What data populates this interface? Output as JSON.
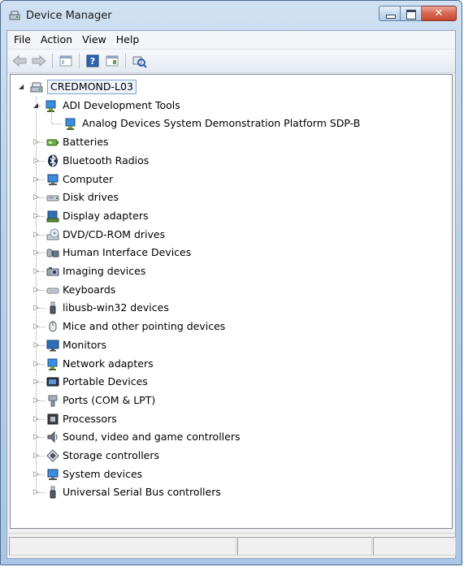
{
  "window": {
    "title": "Device Manager"
  },
  "menu": [
    "File",
    "Action",
    "View",
    "Help"
  ],
  "toolbar": [
    "back-icon",
    "forward-icon",
    "show-hide-tree-icon",
    "help-icon",
    "properties-icon",
    "scan-hardware-icon"
  ],
  "tree": {
    "root": "CREDMOND-L03",
    "expanded": {
      "label": "ADI Development Tools",
      "children": [
        "Analog Devices System Demonstration Platform SDP-B"
      ]
    },
    "categories": [
      {
        "label": "Batteries",
        "icon": "battery-icon"
      },
      {
        "label": "Bluetooth Radios",
        "icon": "bluetooth-icon"
      },
      {
        "label": "Computer",
        "icon": "computer-icon"
      },
      {
        "label": "Disk drives",
        "icon": "disk-drive-icon"
      },
      {
        "label": "Display adapters",
        "icon": "display-adapter-icon"
      },
      {
        "label": "DVD/CD-ROM drives",
        "icon": "dvd-drive-icon"
      },
      {
        "label": "Human Interface Devices",
        "icon": "hid-icon"
      },
      {
        "label": "Imaging devices",
        "icon": "imaging-icon"
      },
      {
        "label": "Keyboards",
        "icon": "keyboard-icon"
      },
      {
        "label": "libusb-win32 devices",
        "icon": "usb-icon"
      },
      {
        "label": "Mice and other pointing devices",
        "icon": "mouse-icon"
      },
      {
        "label": "Monitors",
        "icon": "monitor-icon"
      },
      {
        "label": "Network adapters",
        "icon": "network-icon"
      },
      {
        "label": "Portable Devices",
        "icon": "portable-device-icon"
      },
      {
        "label": "Ports (COM & LPT)",
        "icon": "port-icon"
      },
      {
        "label": "Processors",
        "icon": "processor-icon"
      },
      {
        "label": "Sound, video and game controllers",
        "icon": "sound-icon"
      },
      {
        "label": "Storage controllers",
        "icon": "storage-icon"
      },
      {
        "label": "System devices",
        "icon": "system-icon"
      },
      {
        "label": "Universal Serial Bus controllers",
        "icon": "usb-icon"
      }
    ]
  }
}
